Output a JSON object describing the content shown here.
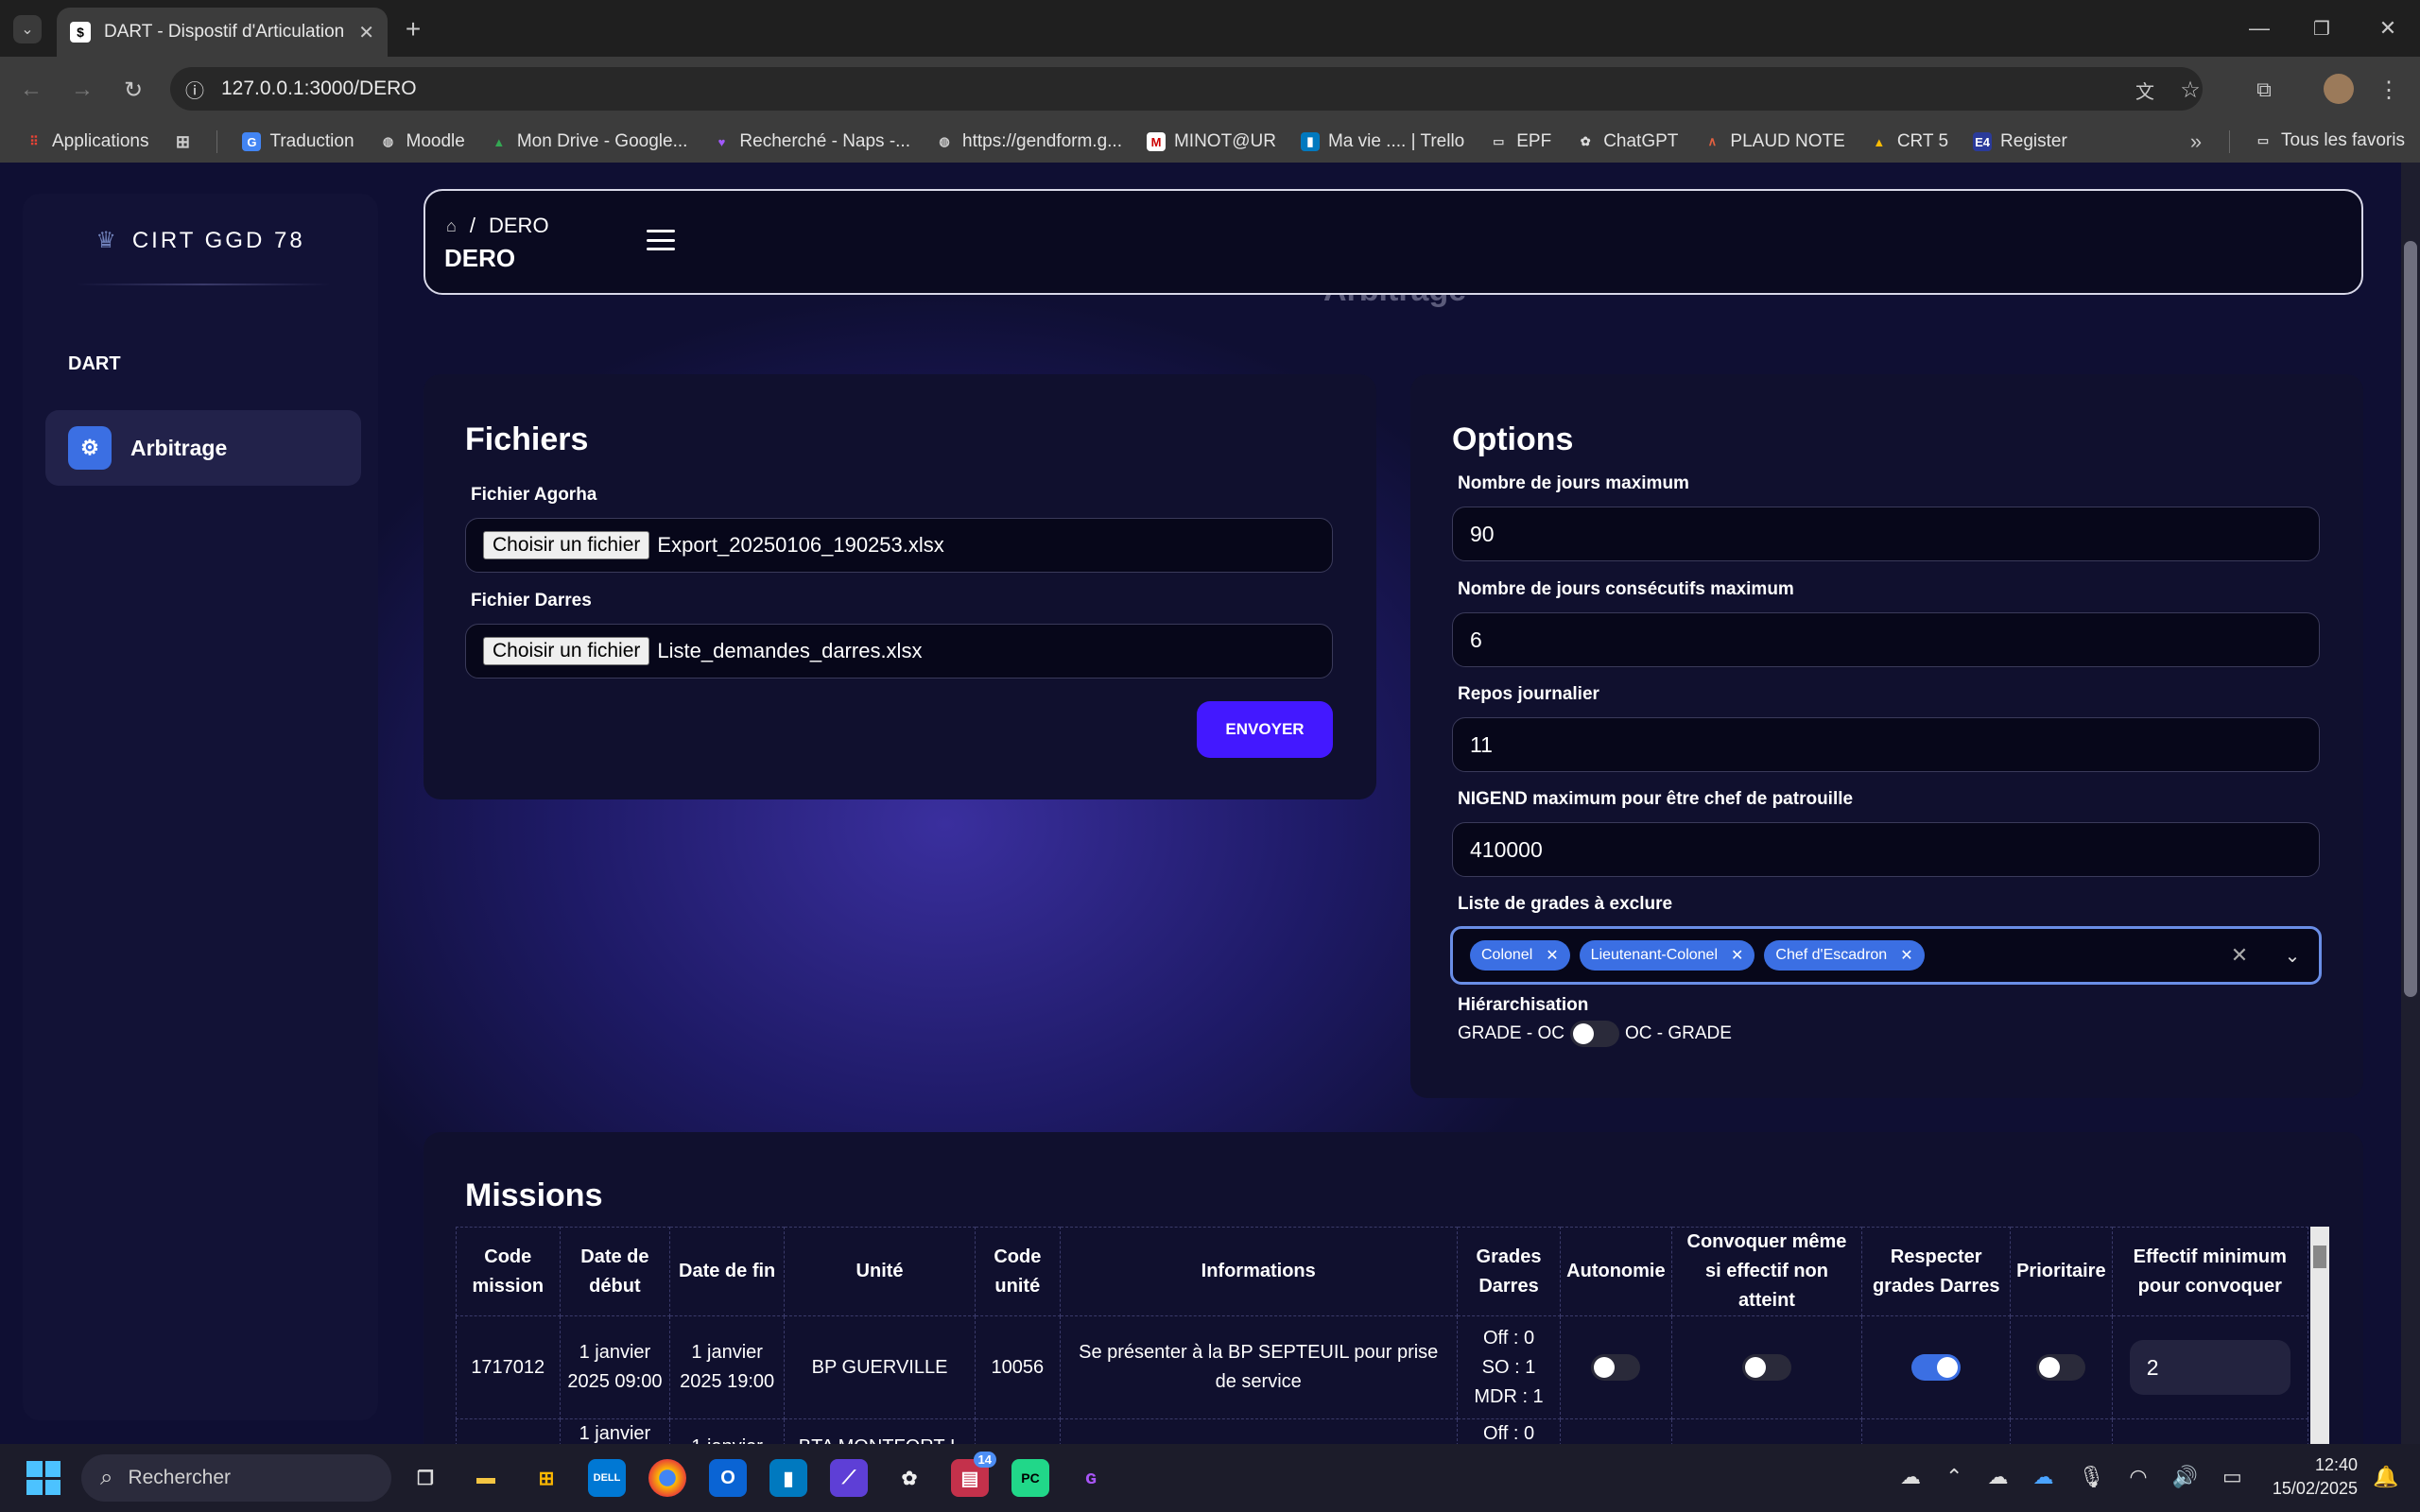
{
  "browser": {
    "tab_title": "DART - Dispostif d'Articulation",
    "url": "127.0.0.1:3000/DERO",
    "bookmarks": [
      {
        "label": "Applications",
        "icon": "apps-grid-icon"
      },
      {
        "label": "",
        "icon": "grid-icon"
      },
      {
        "label": "Traduction",
        "icon": "translate-icon"
      },
      {
        "label": "Moodle",
        "icon": "globe-icon"
      },
      {
        "label": "Mon Drive - Google...",
        "icon": "drive-icon"
      },
      {
        "label": "Recherché - Naps -...",
        "icon": "heart-icon"
      },
      {
        "label": "https://gendform.g...",
        "icon": "globe-icon"
      },
      {
        "label": "MINOT@UR",
        "icon": "minotaur-icon"
      },
      {
        "label": "Ma vie .... | Trello",
        "icon": "trello-icon"
      },
      {
        "label": "EPF",
        "icon": "folder-icon"
      },
      {
        "label": "ChatGPT",
        "icon": "chatgpt-icon"
      },
      {
        "label": "PLAUD NOTE",
        "icon": "plaud-icon"
      },
      {
        "label": "CRT 5",
        "icon": "drive-icon"
      },
      {
        "label": "Register",
        "icon": "e4-icon"
      }
    ],
    "all_bookmarks": "Tous les favoris"
  },
  "sidebar": {
    "brand": "CIRT GGD 78",
    "section": "DART",
    "items": [
      {
        "label": "Arbitrage",
        "icon": "user-gear-icon"
      }
    ]
  },
  "header": {
    "breadcrumb_page": "DERO",
    "title": "DERO",
    "ghost_title": "Arbitrage"
  },
  "files": {
    "title": "Fichiers",
    "agorha_label": "Fichier Agorha",
    "agorha_button": "Choisir un fichier",
    "agorha_value": "Export_20250106_190253.xlsx",
    "darres_label": "Fichier Darres",
    "darres_button": "Choisir un fichier",
    "darres_value": "Liste_demandes_darres.xlsx",
    "send_label": "ENVOYER"
  },
  "options": {
    "title": "Options",
    "max_days_label": "Nombre de jours maximum",
    "max_days_value": "90",
    "max_consecutive_label": "Nombre de jours consécutifs maximum",
    "max_consecutive_value": "6",
    "daily_rest_label": "Repos journalier",
    "daily_rest_value": "11",
    "nigend_label": "NIGEND maximum pour être chef de patrouille",
    "nigend_value": "410000",
    "exclude_label": "Liste de grades à exclure",
    "excluded_grades": [
      "Colonel",
      "Lieutenant-Colonel",
      "Chef d'Escadron"
    ],
    "hierarchy_label": "Hiérarchisation",
    "hierarchy_left": "GRADE - OC",
    "hierarchy_right": "OC - GRADE",
    "hierarchy_on": false
  },
  "missions": {
    "title": "Missions",
    "columns": [
      "Code mission",
      "Date de début",
      "Date de fin",
      "Unité",
      "Code unité",
      "Informations",
      "Grades Darres",
      "Autonomie",
      "Convoquer même si effectif non atteint",
      "Respecter grades Darres",
      "Prioritaire",
      "Effectif minimum pour convoquer"
    ],
    "rows": [
      {
        "code": "1717012",
        "start": "1 janvier 2025 09:00",
        "end": "1 janvier 2025 19:00",
        "unit": "BP GUERVILLE",
        "unit_code": "10056",
        "info": "Se présenter à la BP SEPTEUIL pour prise de service",
        "grades": [
          "Off : 0",
          "SO : 1",
          "MDR : 1"
        ],
        "autonomie": false,
        "convoquer": false,
        "respecter": true,
        "prioritaire": false,
        "effectif": "2"
      },
      {
        "code": "",
        "start": "1 janvier",
        "end": "1 janvier",
        "unit": "BTA MONTFORT-L",
        "unit_code": "",
        "info": "",
        "grades": [
          "Off : 0"
        ],
        "autonomie": false,
        "convoquer": false,
        "respecter": false,
        "prioritaire": false,
        "effectif": ""
      }
    ]
  },
  "taskbar": {
    "search_placeholder": "Rechercher",
    "badge_count": "14",
    "time": "12:40",
    "date": "15/02/2025"
  },
  "colors": {
    "accent": "#3b6fe3",
    "send_button": "#4318ff",
    "card": "#10102e"
  }
}
